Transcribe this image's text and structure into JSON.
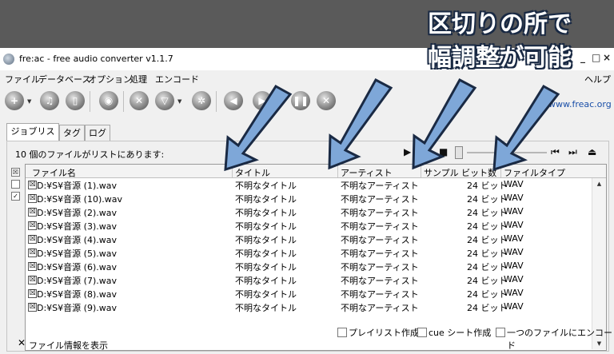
{
  "window": {
    "title": "fre:ac - free audio converter v1.1.7",
    "min": "_",
    "max": "□",
    "close": "×"
  },
  "menu": {
    "items": [
      "ファイル",
      "データベース",
      "オプション",
      "処理",
      "エンコード"
    ],
    "help": "ヘルプ"
  },
  "toolbar": {
    "url": "www.freac.org"
  },
  "tabs": [
    "ジョブリスト",
    "タグ",
    "ログ"
  ],
  "joblist": {
    "count_text": "10 個のファイルがリストにあります:",
    "columns": [
      "ファイル名",
      "タイトル",
      "アーティスト",
      "サンプル ビット数",
      "ファイルタイプ"
    ],
    "rows": [
      {
        "file": "D:¥S¥音源 (1).wav",
        "title": "不明なタイトル",
        "artist": "不明なアーティスト",
        "bits": "24 ビット",
        "type": "WAV"
      },
      {
        "file": "D:¥S¥音源 (10).wav",
        "title": "不明なタイトル",
        "artist": "不明なアーティスト",
        "bits": "24 ビット",
        "type": "WAV"
      },
      {
        "file": "D:¥S¥音源 (2).wav",
        "title": "不明なタイトル",
        "artist": "不明なアーティスト",
        "bits": "24 ビット",
        "type": "WAV"
      },
      {
        "file": "D:¥S¥音源 (3).wav",
        "title": "不明なタイトル",
        "artist": "不明なアーティスト",
        "bits": "24 ビット",
        "type": "WAV"
      },
      {
        "file": "D:¥S¥音源 (4).wav",
        "title": "不明なタイトル",
        "artist": "不明なアーティスト",
        "bits": "24 ビット",
        "type": "WAV"
      },
      {
        "file": "D:¥S¥音源 (5).wav",
        "title": "不明なタイトル",
        "artist": "不明なアーティスト",
        "bits": "24 ビット",
        "type": "WAV"
      },
      {
        "file": "D:¥S¥音源 (6).wav",
        "title": "不明なタイトル",
        "artist": "不明なアーティスト",
        "bits": "24 ビット",
        "type": "WAV"
      },
      {
        "file": "D:¥S¥音源 (7).wav",
        "title": "不明なタイトル",
        "artist": "不明なアーティスト",
        "bits": "24 ビット",
        "type": "WAV"
      },
      {
        "file": "D:¥S¥音源 (8).wav",
        "title": "不明なタイトル",
        "artist": "不明なアーティスト",
        "bits": "24 ビット",
        "type": "WAV"
      },
      {
        "file": "D:¥S¥音源 (9).wav",
        "title": "不明なタイトル",
        "artist": "不明なアーティスト",
        "bits": "24 ビット",
        "type": "WAV"
      }
    ],
    "checkbox_mark": "☒"
  },
  "footer": {
    "playlist": "プレイリスト作成",
    "cuesheet": "cue シート作成",
    "single_file": "一つのファイルにエンコード",
    "show_info": "ファイル情報を表示",
    "show_info_mark": "✕"
  },
  "annotation": {
    "line1": "区切りの所で",
    "line2": "幅調整が可能"
  },
  "colors": {
    "arrow": "#7ea7d8",
    "arrow_outline": "#1a2a44",
    "link": "#1a4fa8"
  }
}
